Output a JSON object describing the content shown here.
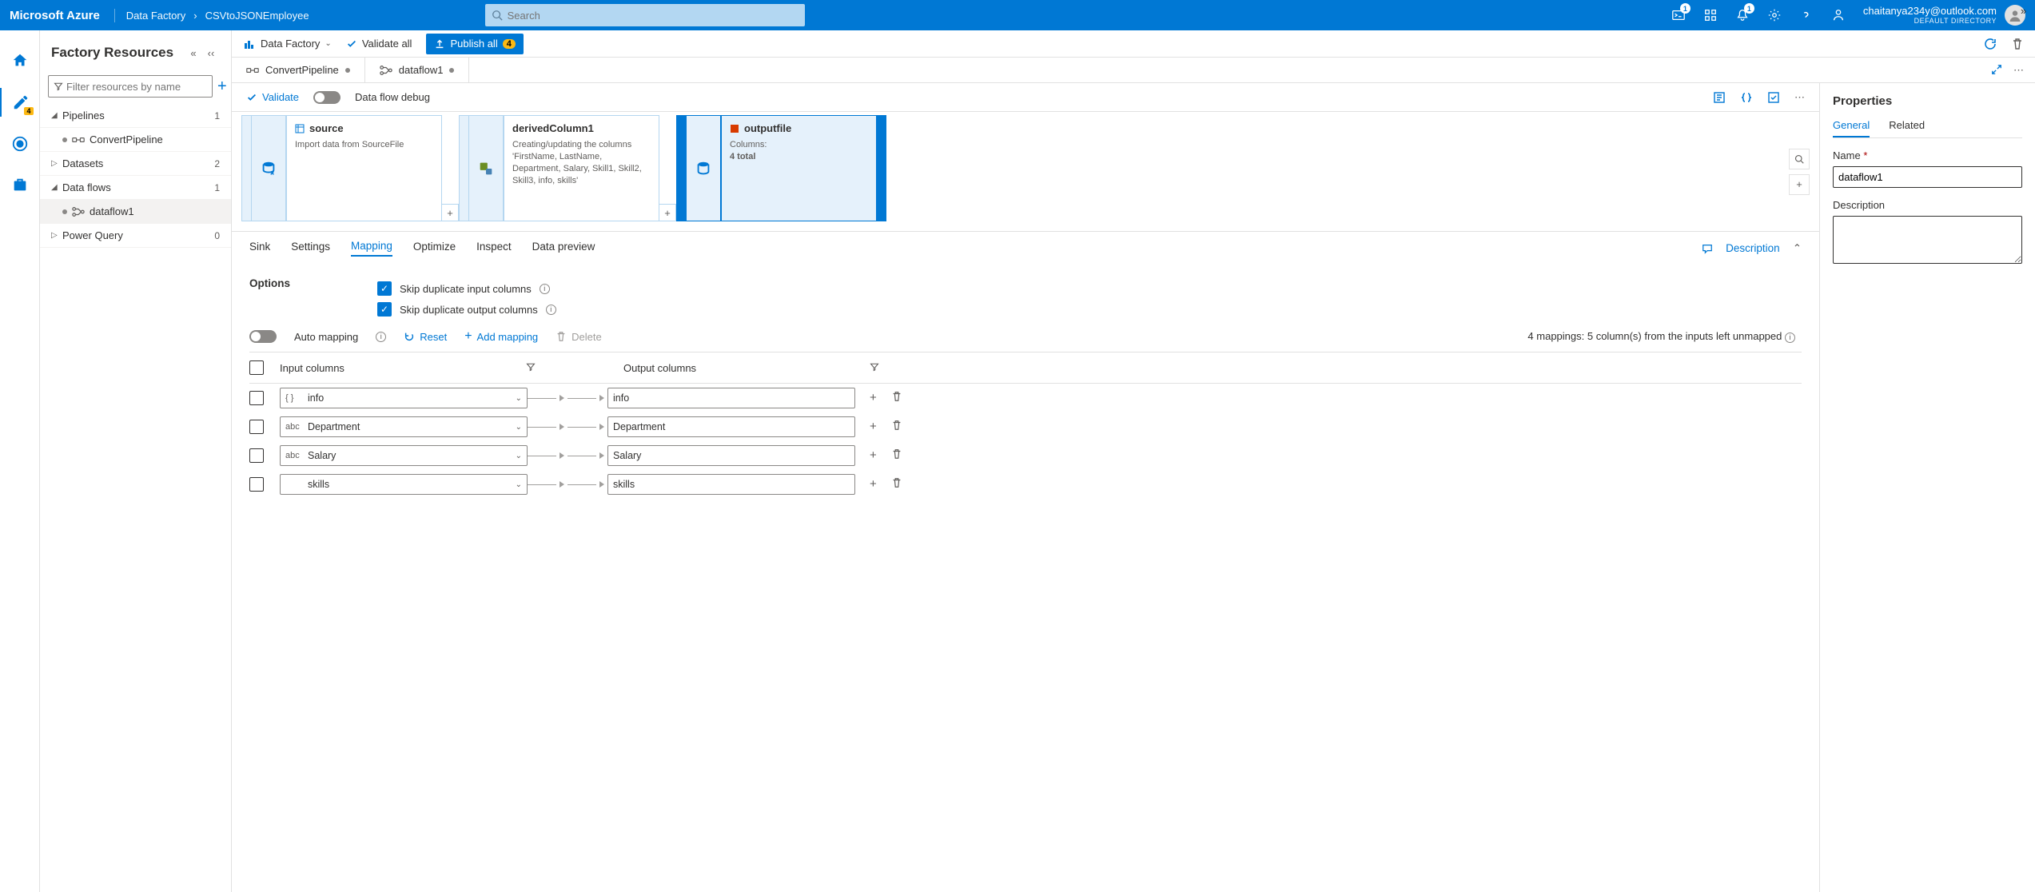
{
  "top": {
    "brand": "Microsoft Azure",
    "crumb1": "Data Factory",
    "crumb2": "CSVtoJSONEmployee",
    "search_placeholder": "Search",
    "badge1": "1",
    "badge2": "1",
    "user": "chaitanya234y@outlook.com",
    "dir": "DEFAULT DIRECTORY"
  },
  "rail": {
    "edit_badge": "4"
  },
  "sidebar": {
    "title": "Factory Resources",
    "filter_placeholder": "Filter resources by name",
    "groups": {
      "pipelines": {
        "label": "Pipelines",
        "count": "1",
        "item": "ConvertPipeline"
      },
      "datasets": {
        "label": "Datasets",
        "count": "2"
      },
      "dataflows": {
        "label": "Data flows",
        "count": "1",
        "item": "dataflow1"
      },
      "powerquery": {
        "label": "Power Query",
        "count": "0"
      }
    }
  },
  "toolbar": {
    "datafactory": "Data Factory",
    "validate_all": "Validate all",
    "publish_all": "Publish all",
    "publish_count": "4"
  },
  "tabs": {
    "t1": "ConvertPipeline",
    "t2": "dataflow1"
  },
  "subbar": {
    "validate": "Validate",
    "debug": "Data flow debug"
  },
  "nodes": {
    "source": {
      "title": "source",
      "desc": "Import data from SourceFile"
    },
    "derived": {
      "title": "derivedColumn1",
      "desc": "Creating/updating the columns 'FirstName, LastName, Department, Salary, Skill1, Skill2, Skill3, info, skills'"
    },
    "sink": {
      "title": "outputfile",
      "l1": "Columns:",
      "l2": "4 total"
    }
  },
  "tabs2": {
    "sink": "Sink",
    "settings": "Settings",
    "mapping": "Mapping",
    "optimize": "Optimize",
    "inspect": "Inspect",
    "preview": "Data preview",
    "description": "Description"
  },
  "panel": {
    "options": "Options",
    "skip_in": "Skip duplicate input columns",
    "skip_out": "Skip duplicate output columns",
    "automap": "Auto mapping",
    "reset": "Reset",
    "addmap": "Add mapping",
    "delete": "Delete",
    "msg": "4 mappings: 5 column(s) from the inputs left unmapped",
    "hdr_in": "Input columns",
    "hdr_out": "Output columns",
    "rows": [
      {
        "type": "{ }",
        "in": "info",
        "out": "info"
      },
      {
        "type": "abc",
        "in": "Department",
        "out": "Department"
      },
      {
        "type": "abc",
        "in": "Salary",
        "out": "Salary"
      },
      {
        "type": "",
        "in": "skills",
        "out": "skills"
      }
    ]
  },
  "props": {
    "title": "Properties",
    "general": "General",
    "related": "Related",
    "name_lbl": "Name",
    "name_val": "dataflow1",
    "desc_lbl": "Description"
  }
}
